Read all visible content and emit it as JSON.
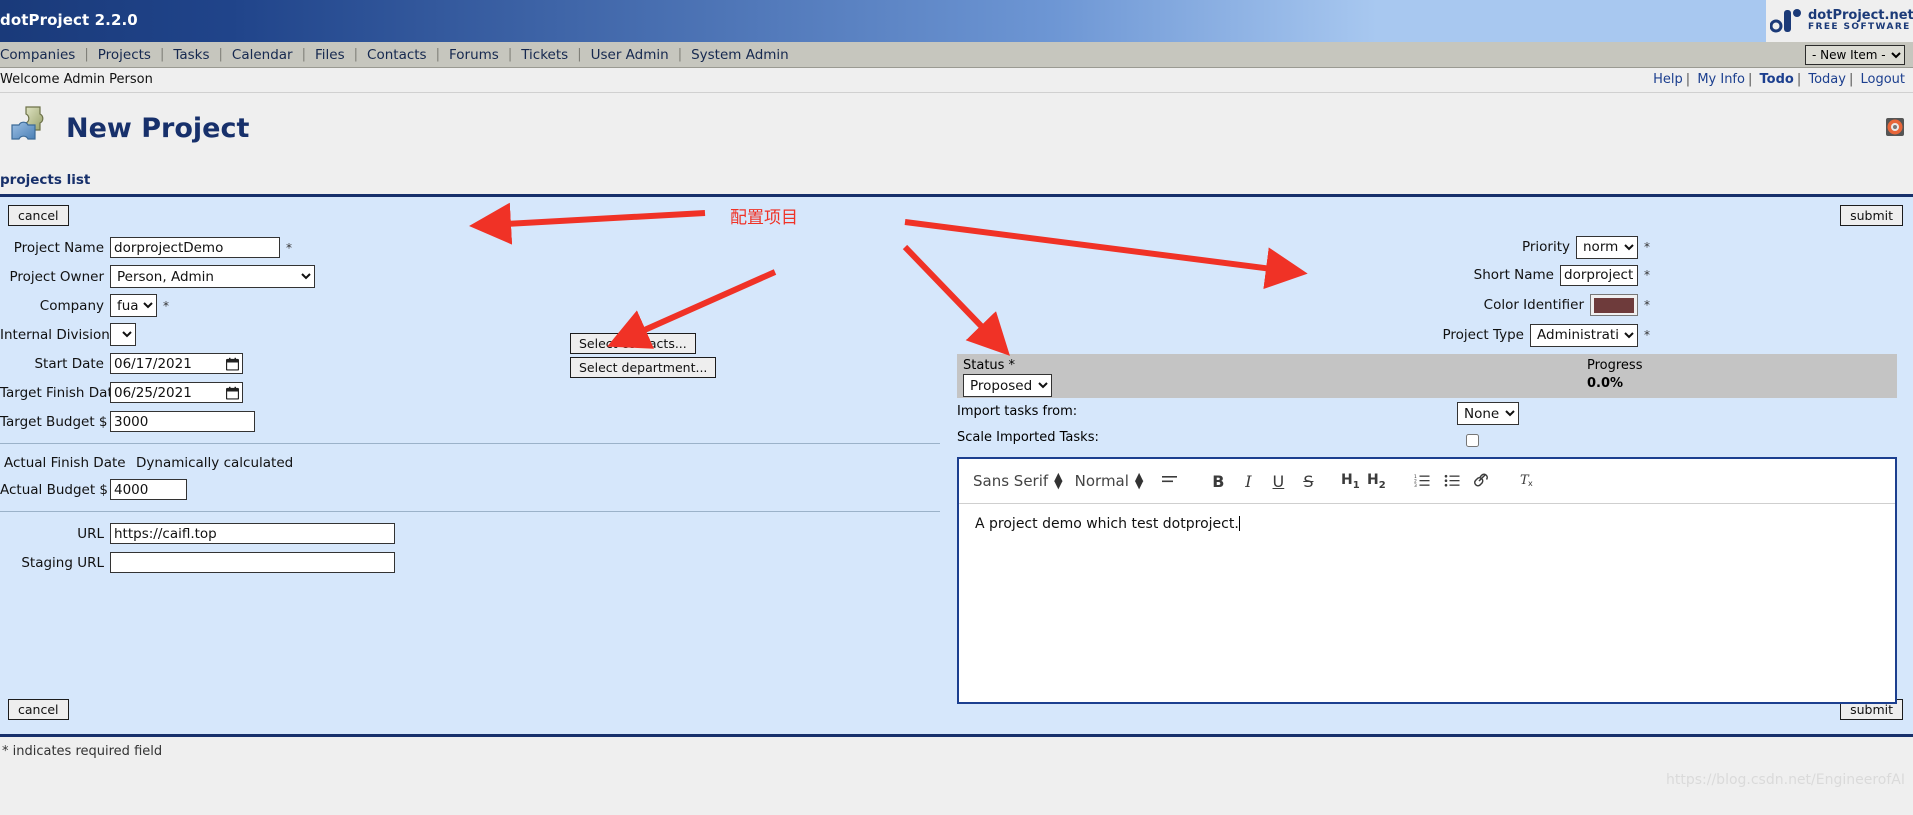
{
  "titlebar": {
    "app_title": "dotProject 2.2.0",
    "logo_line1": "dotProject.net",
    "logo_line2": "FREE SOFTWARE"
  },
  "menubar": {
    "items": [
      "Companies",
      "Projects",
      "Tasks",
      "Calendar",
      "Files",
      "Contacts",
      "Forums",
      "Tickets",
      "User Admin",
      "System Admin"
    ],
    "new_item_label": "- New Item -"
  },
  "welcome": {
    "text": "Welcome Admin Person",
    "links": [
      "Help",
      "My Info",
      "Todo",
      "Today",
      "Logout"
    ]
  },
  "page": {
    "title": "New Project",
    "breadcrumb": "projects list",
    "footnote": "* indicates required field",
    "watermark": "https://blog.csdn.net/EngineerofAI"
  },
  "buttons": {
    "cancel": "cancel",
    "submit": "submit",
    "select_contacts": "Select contacts...",
    "select_department": "Select department..."
  },
  "left_form": {
    "project_name": {
      "label": "Project Name",
      "value": "dorprojectDemo",
      "required": "*"
    },
    "project_owner": {
      "label": "Project Owner",
      "value": "Person, Admin"
    },
    "company": {
      "label": "Company",
      "value": "fua",
      "required": "*"
    },
    "internal_division": {
      "label": "Internal Division",
      "value": ""
    },
    "start_date": {
      "label": "Start Date",
      "value": "06/17/2021"
    },
    "target_finish_date": {
      "label": "Target Finish Date",
      "value": "06/25/2021"
    },
    "target_budget": {
      "label": "Target Budget $",
      "value": "3000"
    },
    "actual_finish_date": {
      "label": "Actual Finish Date",
      "value": "Dynamically calculated"
    },
    "actual_budget": {
      "label": "Actual Budget $",
      "value": "4000"
    },
    "url": {
      "label": "URL",
      "value": "https://caifl.top"
    },
    "staging_url": {
      "label": "Staging URL",
      "value": ""
    }
  },
  "right_form": {
    "priority": {
      "label": "Priority",
      "value": "normal",
      "required": "*"
    },
    "short_name": {
      "label": "Short Name",
      "value": "dorproject",
      "required": "*"
    },
    "color_identifier": {
      "label": "Color Identifier",
      "value": "#6e3b3b",
      "required": "*"
    },
    "project_type": {
      "label": "Project Type",
      "value": "Administrative",
      "required": "*"
    }
  },
  "status_panel": {
    "status_label": "Status *",
    "status_value": "Proposed",
    "progress_label": "Progress",
    "progress_value": "0.0%",
    "import_tasks_label": "Import tasks from:",
    "import_tasks_value": "None",
    "scale_imported_label": "Scale Imported Tasks:"
  },
  "editor": {
    "font_family": "Sans Serif",
    "text_style": "Normal",
    "tools": [
      "align-icon",
      "bold-icon",
      "italic-icon",
      "underline-icon",
      "strikethrough-icon",
      "heading-1-icon",
      "heading-2-icon",
      "ordered-list-icon",
      "bullet-list-icon",
      "link-icon",
      "clear-format-icon"
    ],
    "bold_label": "B",
    "italic_label": "I",
    "underline_label": "U",
    "strike_label": "S",
    "h1_label": "H",
    "h1_sub": "1",
    "h2_label": "H",
    "h2_sub": "2",
    "content": "A project demo which test dotproject."
  },
  "annotation": {
    "text": "配置项目",
    "color": "#f03226"
  }
}
